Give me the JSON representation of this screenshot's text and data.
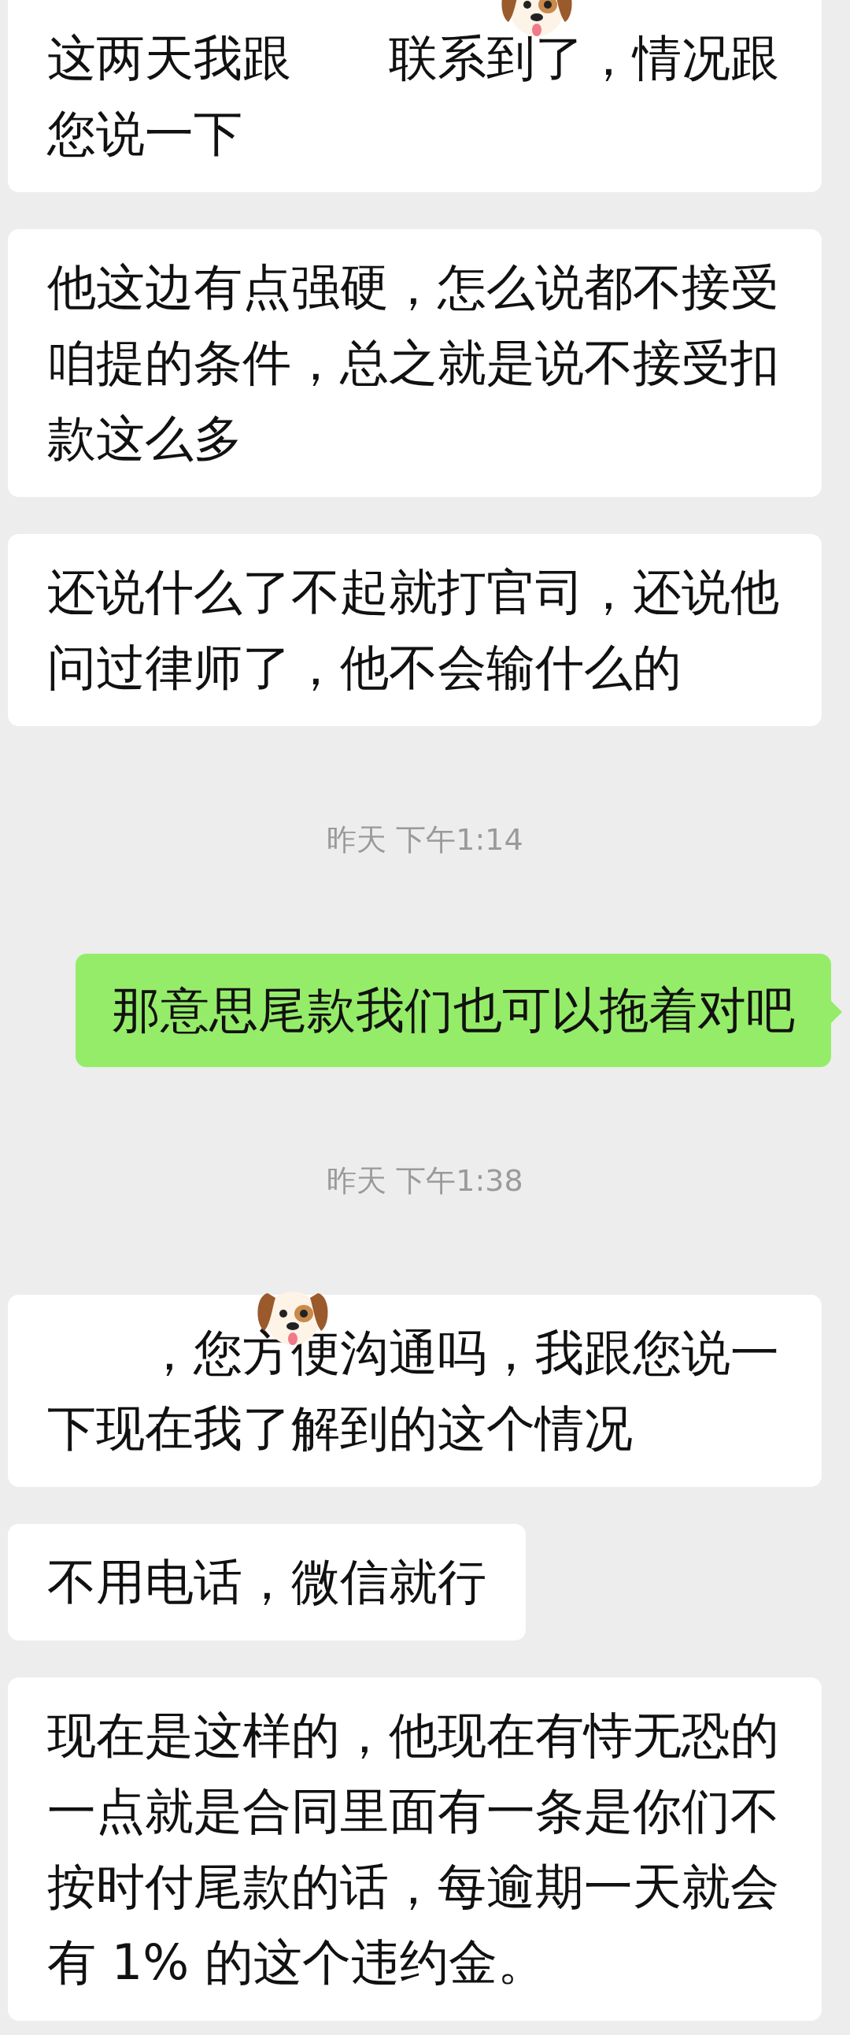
{
  "messages": [
    {
      "kind": "received",
      "text": "这两天我跟　　联系到了，情况跟您说一下",
      "sticker": true
    },
    {
      "kind": "received",
      "text": "他这边有点强硬，怎么说都不接受咱提的条件，总之就是说不接受扣款这么多",
      "sticker": false
    },
    {
      "kind": "received",
      "text": "还说什么了不起就打官司，还说他问过律师了，他不会输什么的",
      "sticker": false
    },
    {
      "kind": "time",
      "text": "昨天 下午1:14"
    },
    {
      "kind": "sent",
      "text": "那意思尾款我们也可以拖着对吧"
    },
    {
      "kind": "time",
      "text": "昨天 下午1:38"
    },
    {
      "kind": "received",
      "text": "　　，您方便沟通吗，我跟您说一下现在我了解到的这个情况",
      "sticker": true
    },
    {
      "kind": "received",
      "text": "不用电话，微信就行",
      "sticker": false
    },
    {
      "kind": "received",
      "text": "现在是这样的，他现在有恃无恐的一点就是合同里面有一条是你们不按时付尾款的话，每逾期一天就会有 1% 的这个违约金。",
      "sticker": false
    }
  ]
}
